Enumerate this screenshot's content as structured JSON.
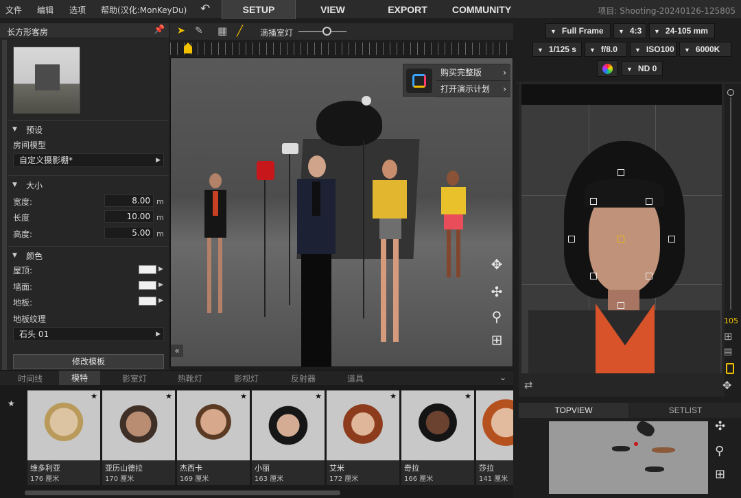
{
  "menu": {
    "items": [
      "文件",
      "编辑",
      "选项",
      "帮助(汉化:MonKeyDu)"
    ],
    "tabs": [
      "SETUP",
      "VIEW",
      "EXPORT",
      "COMMUNITY"
    ],
    "active_tab": "SETUP",
    "project_name": "项目: Shooting-20240126-125805"
  },
  "left_panel": {
    "title": "长方形客房",
    "preset_section": "预设",
    "room_model_label": "房间模型",
    "room_model_value": "自定义摄影棚*",
    "size_section": "大小",
    "width_label": "宽度:",
    "width_value": "8.00",
    "length_label": "长度",
    "length_value": "10.00",
    "height_label": "高度:",
    "height_value": "5.00",
    "unit": "m",
    "color_section": "颜色",
    "ceiling_label": "屋顶:",
    "wall_label": "墙面:",
    "floor_label": "地板:",
    "floor_texture_label": "地板纹理",
    "floor_texture_value": "石头 01",
    "modify_template_button": "修改模板"
  },
  "viewport": {
    "toolbar_label": "滴播室灯",
    "slider_value": 0.45,
    "popup": [
      "购买完整版",
      "打开演示计划"
    ]
  },
  "bottom_tabs": [
    "时间线",
    "模特",
    "影室灯",
    "热靴灯",
    "影视灯",
    "反射器",
    "道具"
  ],
  "active_bottom_tab": "模特",
  "models": [
    {
      "name": "维多利亚",
      "height": "176 厘米"
    },
    {
      "name": "亚历山德拉",
      "height": "170 厘米"
    },
    {
      "name": "杰西卡",
      "height": "169 厘米"
    },
    {
      "name": "小丽",
      "height": "163 厘米"
    },
    {
      "name": "艾米",
      "height": "172 厘米"
    },
    {
      "name": "奇拉",
      "height": "166 厘米"
    },
    {
      "name": "莎拉",
      "height": "141 厘米"
    }
  ],
  "camera": {
    "sensor": "Full Frame",
    "aspect": "4:3",
    "lens": "24-105 mm",
    "shutter": "1/125 s",
    "aperture": "f/8.0",
    "iso": "ISO100",
    "white_balance": "6000K",
    "nd": "ND 0",
    "focal_readout": "105"
  },
  "right_tabs": [
    "TOPVIEW",
    "SETLIST"
  ],
  "colors": {
    "accent_yellow": "#f2c200",
    "bg": "#1e1e1e"
  }
}
